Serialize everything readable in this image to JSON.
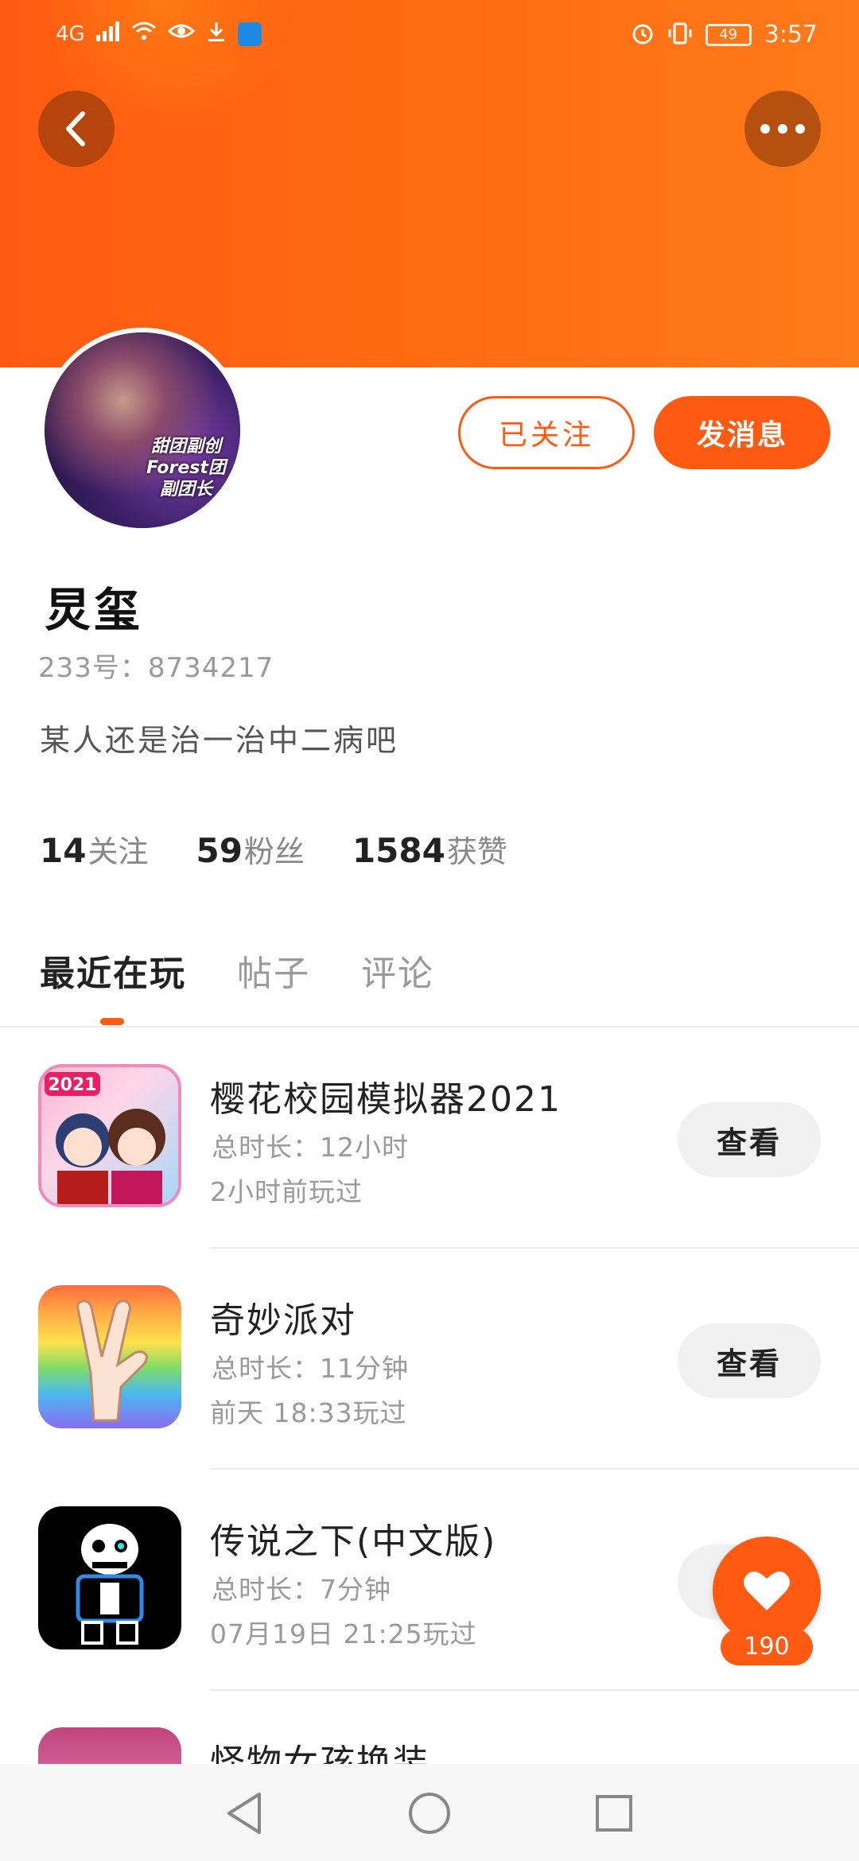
{
  "status_bar": {
    "network": "4G",
    "battery": "49",
    "time": "3:57"
  },
  "profile": {
    "avatar_text": [
      "甜团副创",
      "Forest团",
      "副团长"
    ],
    "username": "炅玺",
    "user_id": "233号：8734217",
    "bio": "某人还是治一治中二病吧",
    "follow_button": "已关注",
    "message_button": "发消息",
    "stats": [
      {
        "value": "14",
        "label": "关注"
      },
      {
        "value": "59",
        "label": "粉丝"
      },
      {
        "value": "1584",
        "label": "获赞"
      }
    ]
  },
  "tabs": [
    {
      "label": "最近在玩",
      "active": true
    },
    {
      "label": "帖子",
      "active": false
    },
    {
      "label": "评论",
      "active": false
    }
  ],
  "games": [
    {
      "title": "樱花校园模拟器2021",
      "duration": "总时长：12小时",
      "played": "2小时前玩过",
      "button": "查看",
      "icon": "sakura-school-icon",
      "badge": "2021"
    },
    {
      "title": "奇妙派对",
      "duration": "总时长：11分钟",
      "played": "前天 18:33玩过",
      "button": "查看",
      "icon": "rainbow-hand-icon"
    },
    {
      "title": "传说之下(中文版)",
      "duration": "总时长：7分钟",
      "played": "07月19日 21:25玩过",
      "button": "查看",
      "icon": "sans-skeleton-icon"
    },
    {
      "title": "怪物女孩换装",
      "icon": "dress-up-icon"
    }
  ],
  "like": {
    "count": "190"
  },
  "colors": {
    "accent": "#ff5a12",
    "muted": "#9a9a9a"
  }
}
